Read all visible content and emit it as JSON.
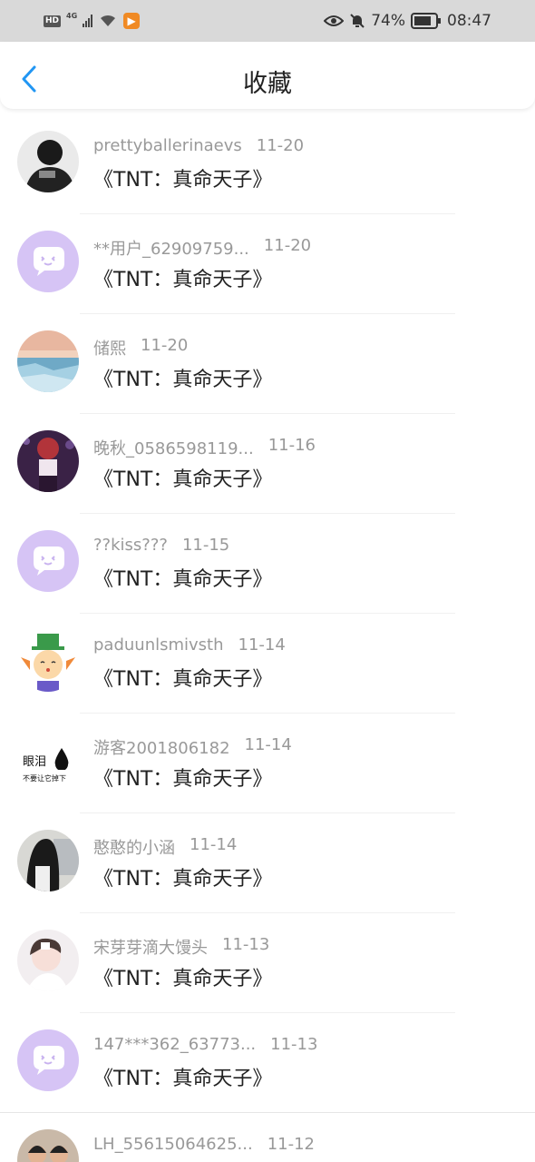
{
  "status": {
    "hd": "HD",
    "net": "4G",
    "battery": "74%",
    "time": "08:47"
  },
  "header": {
    "title": "收藏"
  },
  "items": [
    {
      "user": "prettyballerinaevs",
      "date": "11-20",
      "title": "《TNT：真命天子》",
      "avatar": "dark-photo"
    },
    {
      "user": "**用户_62909759...",
      "date": "11-20",
      "title": "《TNT：真命天子》",
      "avatar": "default-chat"
    },
    {
      "user": "储熙",
      "date": "11-20",
      "title": "《TNT：真命天子》",
      "avatar": "landscape-photo"
    },
    {
      "user": "晚秋_0586598119...",
      "date": "11-16",
      "title": "《TNT：真命天子》",
      "avatar": "purple-photo"
    },
    {
      "user": "??kiss???",
      "date": "11-15",
      "title": "《TNT：真命天子》",
      "avatar": "default-chat"
    },
    {
      "user": "paduunlsmivsth",
      "date": "11-14",
      "title": "《TNT：真命天子》",
      "avatar": "cartoon"
    },
    {
      "user": "游客2001806182",
      "date": "11-14",
      "title": "《TNT：真命天子》",
      "avatar": "text-avatar",
      "avatar_text": "眼泪",
      "avatar_subtext": "不要让它掉下"
    },
    {
      "user": "憨憨的小涵",
      "date": "11-14",
      "title": "《TNT：真命天子》",
      "avatar": "girl-photo"
    },
    {
      "user": "宋芽芽滴大馒头",
      "date": "11-13",
      "title": "《TNT：真命天子》",
      "avatar": "pale-photo"
    },
    {
      "user": "147***362_63773...",
      "date": "11-13",
      "title": "《TNT：真命天子》",
      "avatar": "default-chat"
    },
    {
      "user": "LH_55615064625...",
      "date": "11-12",
      "title": "",
      "avatar": "group-photo"
    }
  ]
}
